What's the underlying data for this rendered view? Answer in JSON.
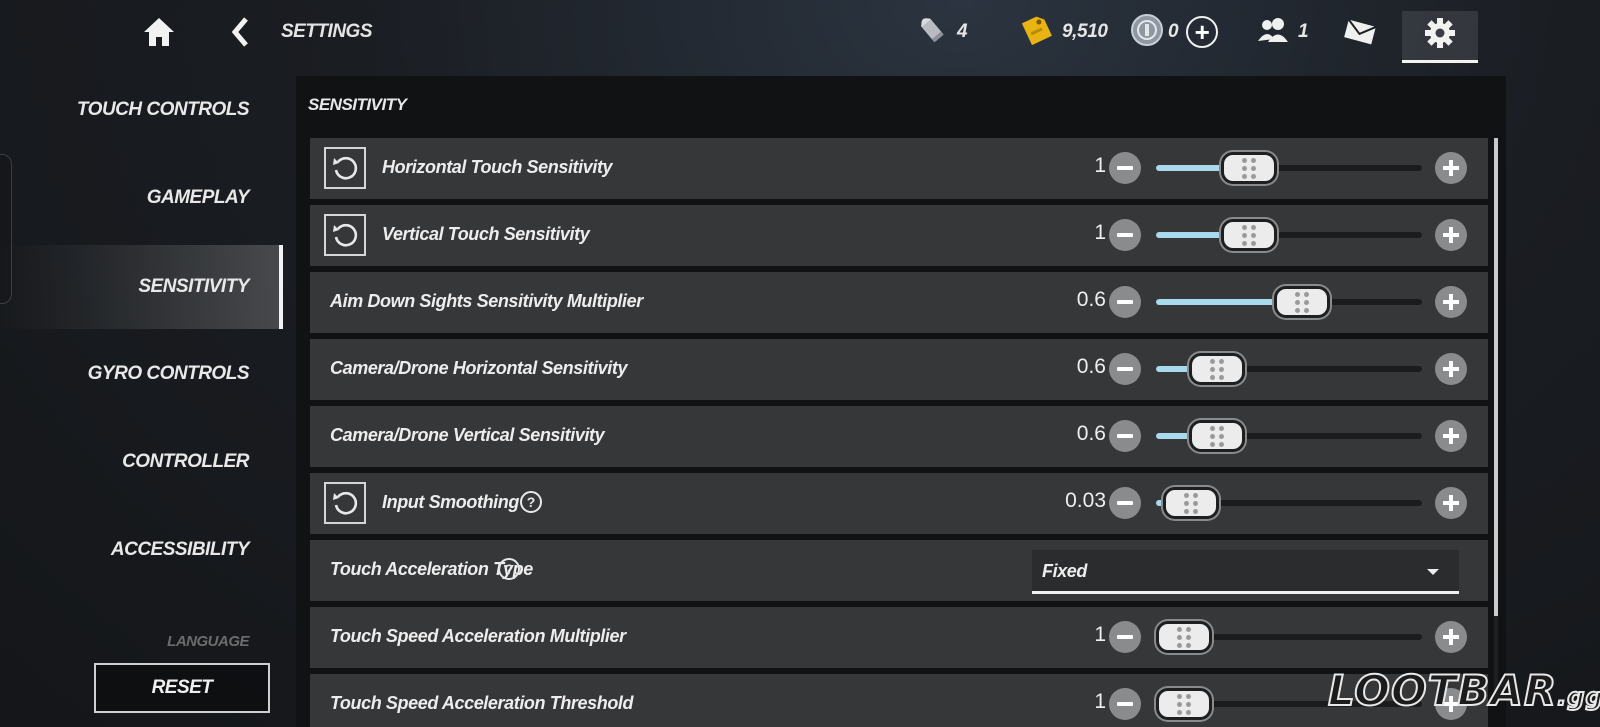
{
  "topbar": {
    "title": "SETTINGS",
    "currencies": [
      {
        "icon": "ammo-icon",
        "value": "4"
      },
      {
        "icon": "credits-tag-icon",
        "value": "9,510"
      },
      {
        "icon": "r6-credits-coin-icon",
        "value": "0"
      }
    ],
    "friends_count": "1",
    "plus_label": "+"
  },
  "sidebar": {
    "items": [
      {
        "label": "TOUCH CONTROLS"
      },
      {
        "label": "GAMEPLAY"
      },
      {
        "label": "SENSITIVITY"
      },
      {
        "label": "GYRO CONTROLS"
      },
      {
        "label": "CONTROLLER"
      },
      {
        "label": "ACCESSIBILITY"
      },
      {
        "label": "LANGUAGE"
      }
    ],
    "active": "SENSITIVITY",
    "reset_label": "RESET"
  },
  "panel": {
    "section_title": "SENSITIVITY",
    "settings": [
      {
        "label": "Horizontal Touch Sensitivity",
        "value": "1",
        "level": 0.35,
        "has_reset": true,
        "has_help": false
      },
      {
        "label": "Vertical Touch Sensitivity",
        "value": "1",
        "level": 0.35,
        "has_reset": true,
        "has_help": false
      },
      {
        "label": "Aim Down Sights Sensitivity Multiplier",
        "value": "0.6",
        "level": 0.55,
        "has_reset": false,
        "has_help": false
      },
      {
        "label": "Camera/Drone Horizontal Sensitivity",
        "value": "0.6",
        "level": 0.23,
        "has_reset": false,
        "has_help": false
      },
      {
        "label": "Camera/Drone Vertical Sensitivity",
        "value": "0.6",
        "level": 0.23,
        "has_reset": false,
        "has_help": false
      },
      {
        "label": "Input Smoothing",
        "value": "0.03",
        "level": 0.13,
        "has_reset": true,
        "has_help": true
      },
      {
        "label": "Touch Acceleration Type",
        "dropdown": "Fixed",
        "has_help": true
      },
      {
        "label": "Touch Speed Acceleration Multiplier",
        "value": "1",
        "level": 0.09,
        "has_reset": false,
        "has_help": false
      },
      {
        "label": "Touch Speed Acceleration Threshold",
        "value": "1",
        "level": 0.09,
        "has_reset": false,
        "has_help": false
      }
    ]
  },
  "watermark": {
    "brand": "LOOTBAR",
    "suffix": ".gg"
  },
  "colors": {
    "slider_fill": "#a8d9ec",
    "row_bg": "#363739",
    "panel_bg": "#101214"
  }
}
